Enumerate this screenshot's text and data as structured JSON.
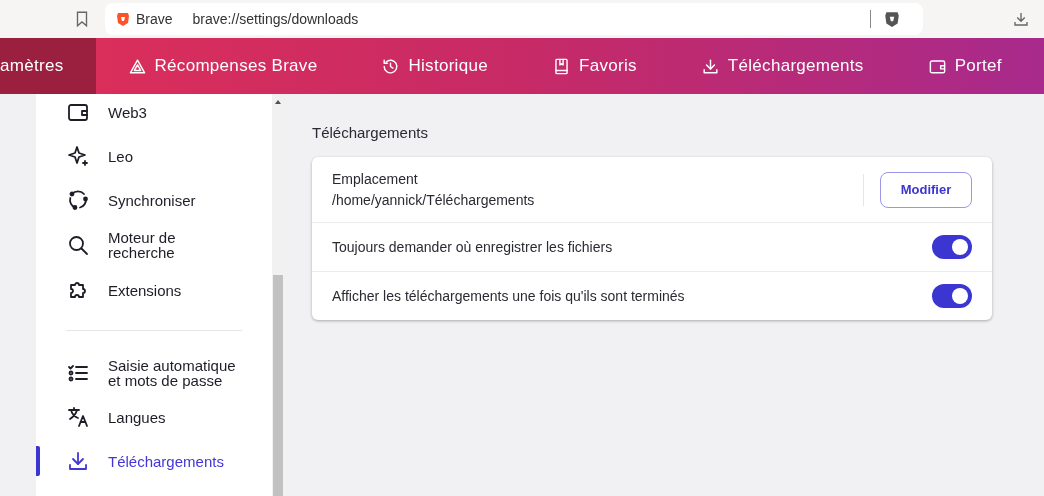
{
  "browser": {
    "site_label": "Brave",
    "url": "brave://settings/downloads"
  },
  "nav_tabs": [
    {
      "label": "amètres",
      "kind": "plain",
      "selected": true
    },
    {
      "label": "Récompenses Brave",
      "kind": "rewards",
      "selected": false
    },
    {
      "label": "Historique",
      "kind": "history",
      "selected": false
    },
    {
      "label": "Favoris",
      "kind": "bookmarks",
      "selected": false
    },
    {
      "label": "Téléchargements",
      "kind": "downloads",
      "selected": false
    },
    {
      "label": "Portef",
      "kind": "wallet",
      "selected": false
    }
  ],
  "sidebar": {
    "groups": [
      [
        {
          "label": "Web3",
          "kind": "wallet",
          "selected": false
        },
        {
          "label": "Leo",
          "kind": "leo",
          "selected": false
        },
        {
          "label": "Synchroniser",
          "kind": "sync",
          "selected": false
        },
        {
          "label": "Moteur de recherche",
          "kind": "search",
          "selected": false
        },
        {
          "label": "Extensions",
          "kind": "extensions",
          "selected": false
        }
      ],
      [
        {
          "label": "Saisie automatique et mots de passe",
          "kind": "autofill",
          "selected": false
        },
        {
          "label": "Langues",
          "kind": "languages",
          "selected": false
        },
        {
          "label": "Téléchargements",
          "kind": "downloads",
          "selected": true
        }
      ]
    ]
  },
  "section_title": "Téléchargements",
  "rows": [
    {
      "kind": "location",
      "label": "Emplacement",
      "value": "/home/yannick/Téléchargements",
      "button": "Modifier"
    },
    {
      "kind": "toggle",
      "label": "Toujours demander où enregistrer les fichiers",
      "on": true
    },
    {
      "kind": "toggle",
      "label": "Afficher les téléchargements une fois qu'ils sont terminés",
      "on": true
    }
  ]
}
